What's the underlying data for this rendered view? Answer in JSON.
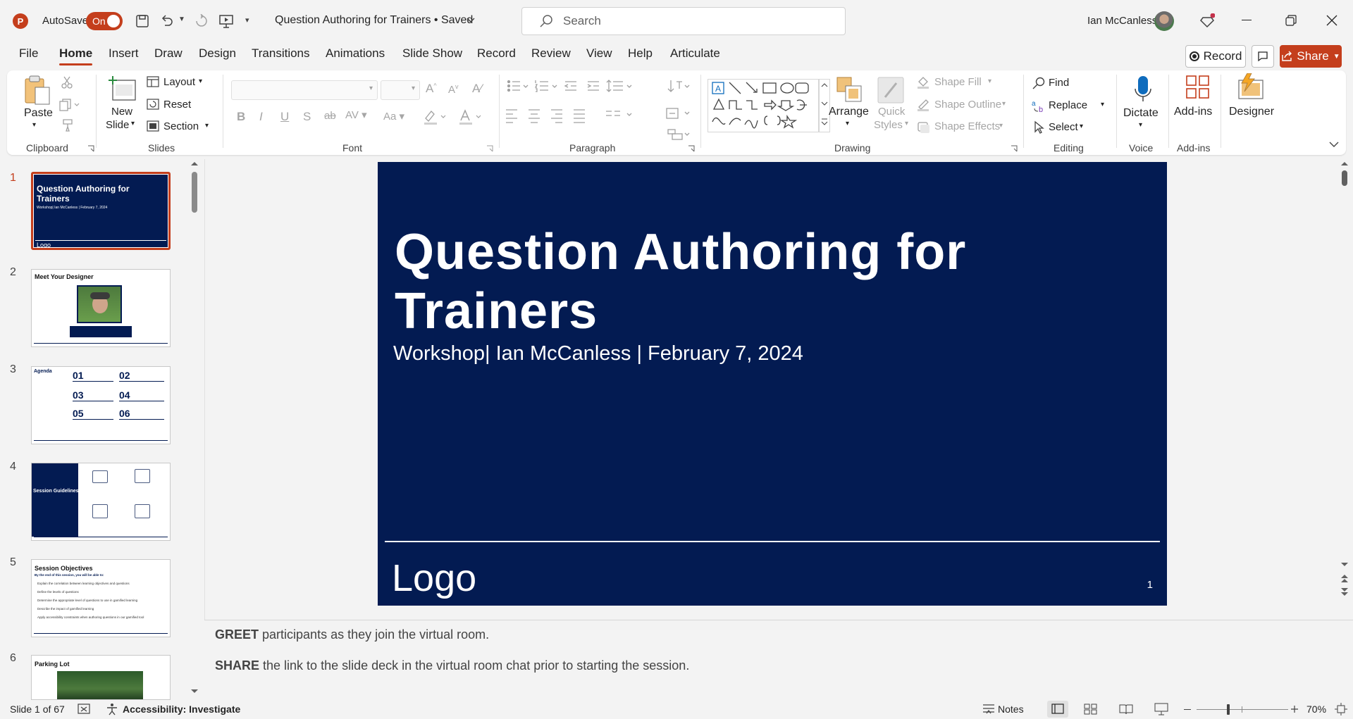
{
  "titlebar": {
    "autosave_label": "AutoSave",
    "autosave_state": "On",
    "doc_title": "Question Authoring for Trainers • Saved",
    "search_placeholder": "Search",
    "user_name": "Ian McCanless"
  },
  "tabs": [
    "File",
    "Home",
    "Insert",
    "Draw",
    "Design",
    "Transitions",
    "Animations",
    "Slide Show",
    "Record",
    "Review",
    "View",
    "Help",
    "Articulate"
  ],
  "tab_actions": {
    "record": "Record",
    "share": "Share"
  },
  "ribbon": {
    "clipboard": {
      "paste": "Paste",
      "group": "Clipboard"
    },
    "slides": {
      "new_slide_1": "New",
      "new_slide_2": "Slide",
      "layout": "Layout",
      "reset": "Reset",
      "section": "Section",
      "group": "Slides"
    },
    "font": {
      "group": "Font"
    },
    "paragraph": {
      "group": "Paragraph"
    },
    "drawing": {
      "arrange": "Arrange",
      "quick_styles_1": "Quick",
      "quick_styles_2": "Styles",
      "shape_fill": "Shape Fill",
      "shape_outline": "Shape Outline",
      "shape_effects": "Shape Effects",
      "group": "Drawing"
    },
    "editing": {
      "find": "Find",
      "replace": "Replace",
      "select": "Select",
      "group": "Editing"
    },
    "voice": {
      "dictate": "Dictate",
      "group": "Voice"
    },
    "addins": {
      "addins": "Add-ins",
      "group": "Add-ins"
    },
    "designer": {
      "label": "Designer"
    }
  },
  "thumbnails": [
    {
      "num": "1",
      "title": "Question Authoring for Trainers",
      "subtitle": "Workshop| Ian McCanless | February 7, 2024",
      "logo": "Logo"
    },
    {
      "num": "2",
      "title": "Meet Your Designer"
    },
    {
      "num": "3",
      "title": "Agenda",
      "items": [
        "01",
        "02",
        "03",
        "04",
        "05",
        "06"
      ]
    },
    {
      "num": "4",
      "title": "Session Guidelines"
    },
    {
      "num": "5",
      "title": "Session Objectives",
      "lead": "By the end of this session, you will be able to:",
      "bullets": [
        "Explain the correlation between learning objectives and questions",
        "Define the levels of questions",
        "Determine the appropriate level of questions to use in gamified learning",
        "Describe the impact of gamified learning",
        "Apply accessibility constraints when authoring questions in our gamified tool"
      ]
    },
    {
      "num": "6",
      "title": "Parking Lot"
    }
  ],
  "slide": {
    "title": "Question Authoring for Trainers",
    "subtitle": "Workshop| Ian McCanless | February 7, 2024",
    "logo": "Logo",
    "page_number": "1"
  },
  "notes": {
    "line1_bold": "GREET",
    "line1_rest": " participants as they join the virtual room.",
    "line2_bold": "SHARE",
    "line2_rest": " the link to the slide deck in the virtual room chat prior to starting the session."
  },
  "status": {
    "slide_count": "Slide 1 of 67",
    "accessibility": "Accessibility: Investigate",
    "notes": "Notes",
    "zoom": "70%"
  },
  "colors": {
    "accent": "#c43e1c",
    "slide_bg": "#031b52"
  }
}
